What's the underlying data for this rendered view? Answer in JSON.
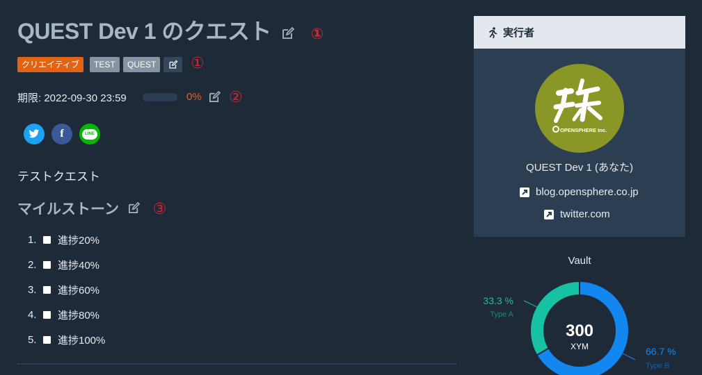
{
  "quest": {
    "title": "QUEST Dev 1 のクエスト",
    "annotation_1": "①",
    "annotation_2": "②",
    "annotation_3": "③",
    "tags": [
      "クリエイティブ",
      "TEST",
      "QUEST"
    ],
    "deadline": "期限: 2022-09-30 23:59",
    "progress": 0,
    "progress_label": "0%",
    "description": "テストクエスト",
    "colors": {
      "accent": "#e36315",
      "annotation": "#d9232e"
    }
  },
  "social": [
    {
      "name": "twitter",
      "glyph": "",
      "color": "#1da1f2"
    },
    {
      "name": "facebook",
      "glyph": "f",
      "color": "#3b5998"
    },
    {
      "name": "line",
      "glyph": "LINE",
      "color": "#00b900"
    }
  ],
  "milestones": {
    "title": "マイルストーン",
    "items": [
      {
        "num": "1.",
        "label": "進捗20%",
        "checked": false
      },
      {
        "num": "2.",
        "label": "進捗40%",
        "checked": false
      },
      {
        "num": "3.",
        "label": "進捗60%",
        "checked": false
      },
      {
        "num": "4.",
        "label": "進捗80%",
        "checked": false
      },
      {
        "num": "5.",
        "label": "進捗100%",
        "checked": false
      }
    ]
  },
  "performer": {
    "header": "実行者",
    "icon": "running-person-icon",
    "logo_text": "OPENSPHERE Inc.",
    "name": "QUEST Dev 1 (あなた)",
    "links": [
      "blog.opensphere.co.jp",
      "twitter.com"
    ]
  },
  "vault": {
    "title": "Vault",
    "total": "300",
    "unit": "XYM",
    "chart_data": {
      "type": "pie",
      "categories": [
        "Type A",
        "Type B"
      ],
      "values": [
        33.3,
        66.7
      ],
      "labels": [
        "33.3 %",
        "66.7 %"
      ],
      "colors": [
        "#16c2a3",
        "#1387f0"
      ],
      "center_text": "300 XYM"
    }
  }
}
